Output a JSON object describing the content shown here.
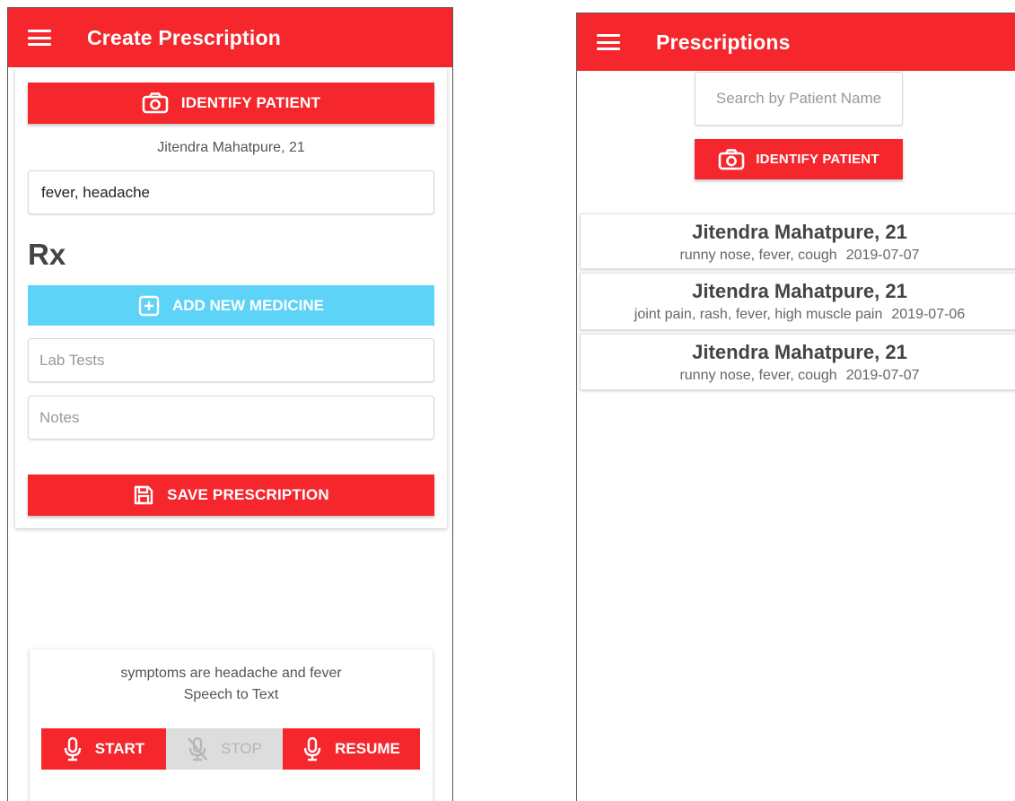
{
  "create_screen": {
    "title": "Create Prescription",
    "identify_button": "IDENTIFY PATIENT",
    "patient_label": "Jitendra Mahatpure, 21",
    "symptoms_value": "fever, headache",
    "rx_heading": "Rx",
    "add_medicine_button": "ADD NEW MEDICINE",
    "lab_tests_placeholder": "Lab Tests",
    "notes_placeholder": "Notes",
    "save_button": "SAVE PRESCRIPTION",
    "speech": {
      "transcript": "symptoms are headache and fever",
      "caption": "Speech to Text",
      "start_label": "START",
      "stop_label": "STOP",
      "resume_label": "RESUME"
    }
  },
  "list_screen": {
    "title": "Prescriptions",
    "search_placeholder": "Search by Patient Name",
    "identify_button": "IDENTIFY PATIENT",
    "items": [
      {
        "name": "Jitendra Mahatpure, 21",
        "symptoms": "runny nose, fever, cough",
        "date": "2019-07-07"
      },
      {
        "name": "Jitendra Mahatpure, 21",
        "symptoms": "joint pain, rash, fever, high  muscle pain",
        "date": "2019-07-06"
      },
      {
        "name": "Jitendra Mahatpure, 21",
        "symptoms": "runny nose, fever, cough",
        "date": "2019-07-07"
      }
    ]
  },
  "colors": {
    "primary_red": "#f5272d",
    "accent_blue": "#5dd3f8",
    "disabled_gray": "#dddddd"
  },
  "icons": [
    "menu-icon",
    "camera-icon",
    "plus-box-icon",
    "save-icon",
    "mic-icon",
    "mic-off-icon"
  ]
}
